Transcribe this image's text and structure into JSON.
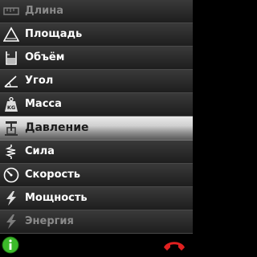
{
  "menu": {
    "items": [
      {
        "label": "Длина",
        "icon": "ruler-icon"
      },
      {
        "label": "Площадь",
        "icon": "triangle-area-icon"
      },
      {
        "label": "Объём",
        "icon": "beaker-volume-icon"
      },
      {
        "label": "Угол",
        "icon": "angle-icon"
      },
      {
        "label": "Масса",
        "icon": "weight-kg-icon"
      },
      {
        "label": "Давление",
        "icon": "pressure-gauge-icon"
      },
      {
        "label": "Сила",
        "icon": "spring-force-icon"
      },
      {
        "label": "Скорость",
        "icon": "speedometer-icon"
      },
      {
        "label": "Мощность",
        "icon": "lightning-power-icon"
      },
      {
        "label": "Энергия",
        "icon": "energy-icon"
      }
    ],
    "selected_label": "Давление"
  },
  "softkeys": {
    "left": "info-icon",
    "right": "end-call-icon"
  },
  "colors": {
    "selected_row": "#d0d0d0",
    "row": "#2a2a2a",
    "info_button": "#3cba2a",
    "end_call": "#e02020"
  }
}
